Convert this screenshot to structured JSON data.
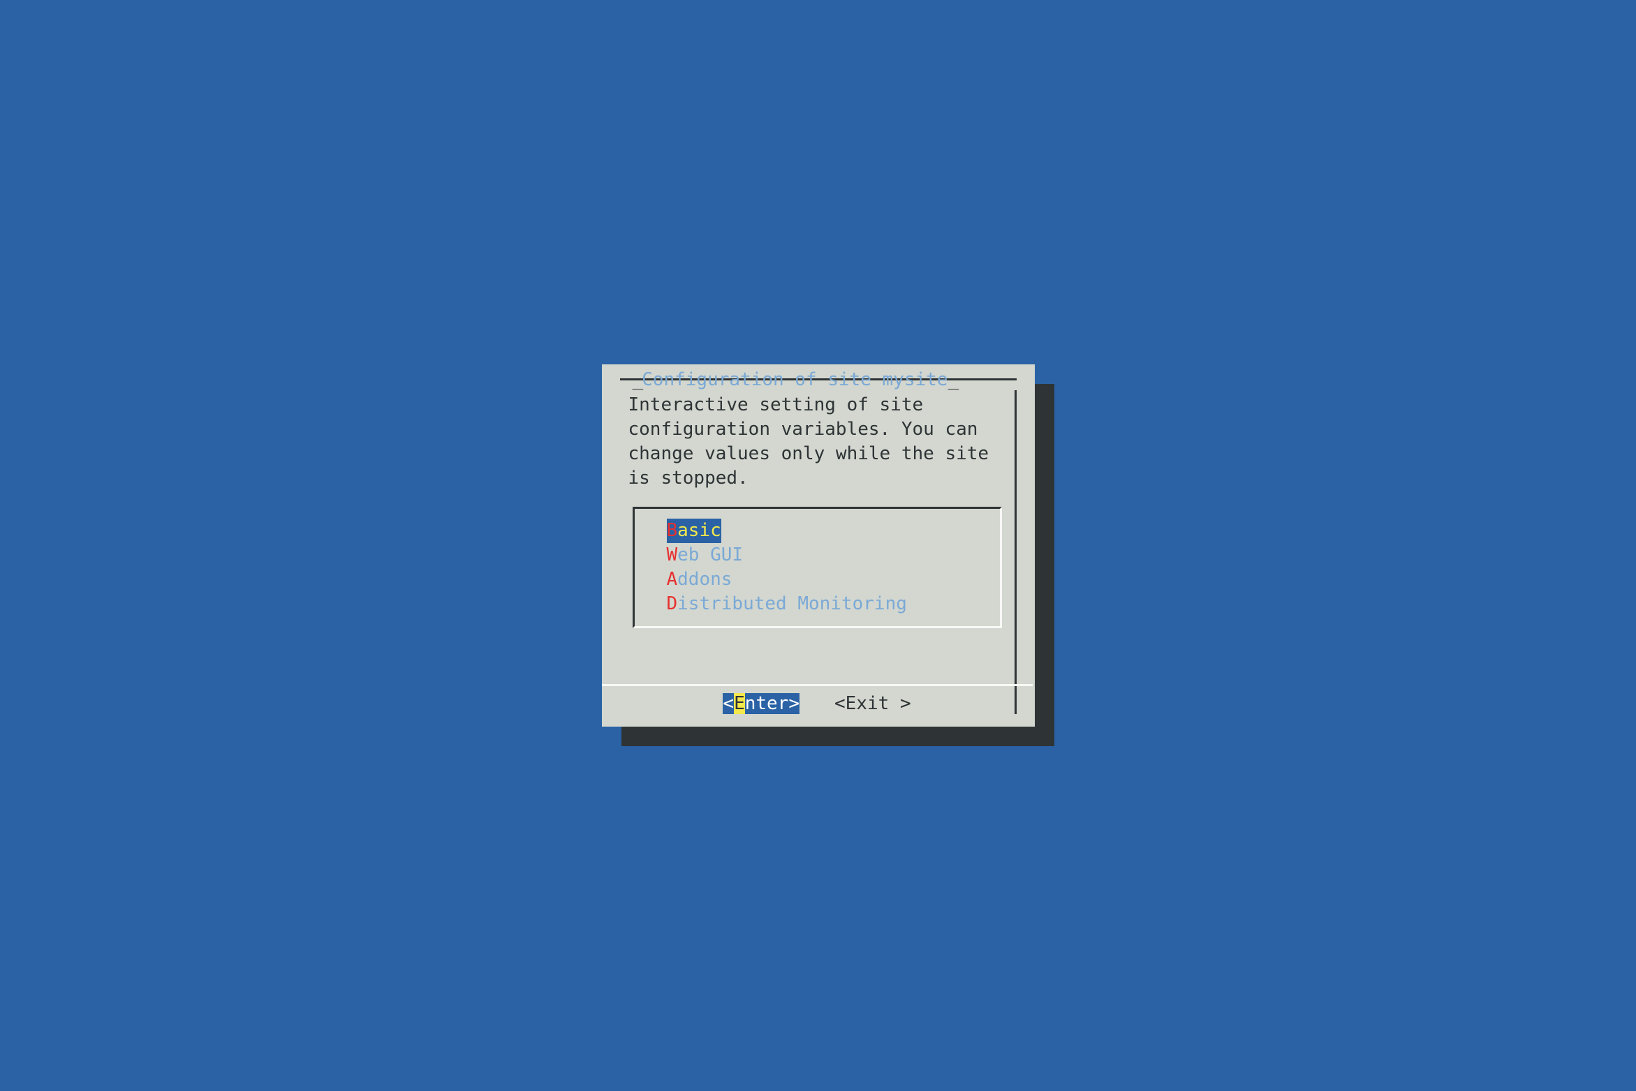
{
  "dialog": {
    "title": "Configuration of site mysite",
    "description": "Interactive setting of site configuration variables. You can change values only while the site is stopped."
  },
  "menu": {
    "items": [
      {
        "hotkey": "B",
        "rest": "asic",
        "selected": true
      },
      {
        "hotkey": "W",
        "rest": "eb GUI",
        "selected": false
      },
      {
        "hotkey": "A",
        "rest": "ddons",
        "selected": false
      },
      {
        "hotkey": "D",
        "rest": "istributed Monitoring",
        "selected": false
      }
    ]
  },
  "buttons": {
    "enter": {
      "open": "<",
      "hotkey": "E",
      "rest": "nter",
      "close": ">",
      "selected": true
    },
    "exit": {
      "open": "<",
      "hotkey": "E",
      "rest": "xit ",
      "close": ">",
      "selected": false
    }
  }
}
